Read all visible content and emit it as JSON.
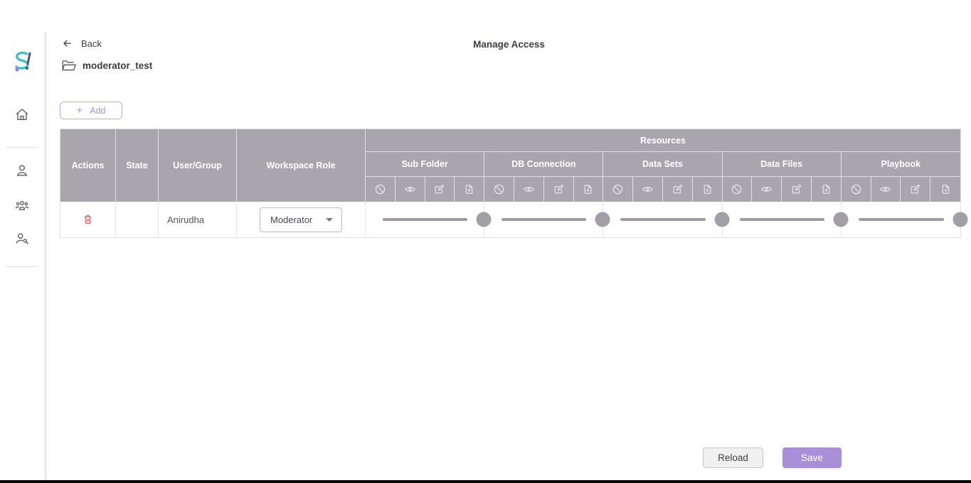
{
  "header": {
    "back_label": "Back",
    "title": "Manage Access",
    "workspace_name": "moderator_test"
  },
  "toolbar": {
    "add_label": "Add"
  },
  "sidebar": {
    "items": [
      {
        "icon": "home-icon"
      },
      {
        "icon": "user-icon"
      },
      {
        "icon": "user-group-icon"
      },
      {
        "icon": "user-key-icon"
      }
    ],
    "collapse_icon": "chevron-right-icon"
  },
  "table": {
    "columns": {
      "actions": "Actions",
      "state": "State",
      "user_group": "User/Group",
      "workspace_role": "Workspace Role"
    },
    "resources_label": "Resources",
    "groups": [
      {
        "label": "Sub Folder"
      },
      {
        "label": "DB Connection"
      },
      {
        "label": "Data Sets"
      },
      {
        "label": "Data Files"
      },
      {
        "label": "Playbook"
      }
    ],
    "permission_icons": [
      "deny-icon",
      "view-icon",
      "edit-icon",
      "add-file-icon"
    ],
    "row": {
      "user": "Anirudha",
      "state": "",
      "workspace_role": "Moderator",
      "slider_values": [
        100,
        100,
        100,
        100,
        100
      ]
    }
  },
  "footer": {
    "reload_label": "Reload",
    "save_label": "Save"
  },
  "colors": {
    "header_bg": "#a8a5ad",
    "accent_purple": "#a98fd8",
    "danger_red": "#e25663",
    "slider_gray": "#9d9aa3"
  }
}
